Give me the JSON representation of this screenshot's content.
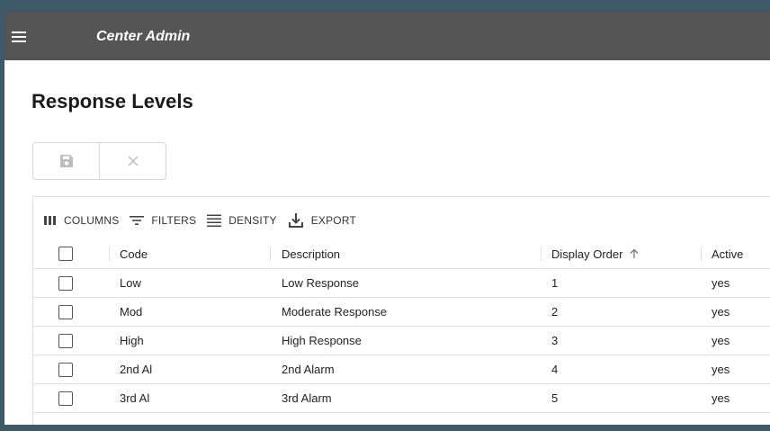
{
  "app": {
    "title": "Center Admin"
  },
  "page": {
    "title": "Response Levels"
  },
  "grid_toolbar": {
    "columns": "COLUMNS",
    "filters": "FILTERS",
    "density": "DENSITY",
    "export": "EXPORT"
  },
  "columns": {
    "code": "Code",
    "description": "Description",
    "display_order": "Display Order",
    "active": "Active"
  },
  "sort": {
    "column": "display_order",
    "direction": "ascending"
  },
  "rows": [
    {
      "code": "Low",
      "description": "Low Response",
      "display_order": "1",
      "active": "yes"
    },
    {
      "code": "Mod",
      "description": "Moderate Response",
      "display_order": "2",
      "active": "yes"
    },
    {
      "code": "High",
      "description": "High Response",
      "display_order": "3",
      "active": "yes"
    },
    {
      "code": "2nd Al",
      "description": "2nd Alarm",
      "display_order": "4",
      "active": "yes"
    },
    {
      "code": "3rd Al",
      "description": "3rd Alarm",
      "display_order": "5",
      "active": "yes"
    }
  ],
  "colors": {
    "app_bar": "#555555",
    "outer_background": "#3d5a66",
    "icon": "#444444"
  }
}
